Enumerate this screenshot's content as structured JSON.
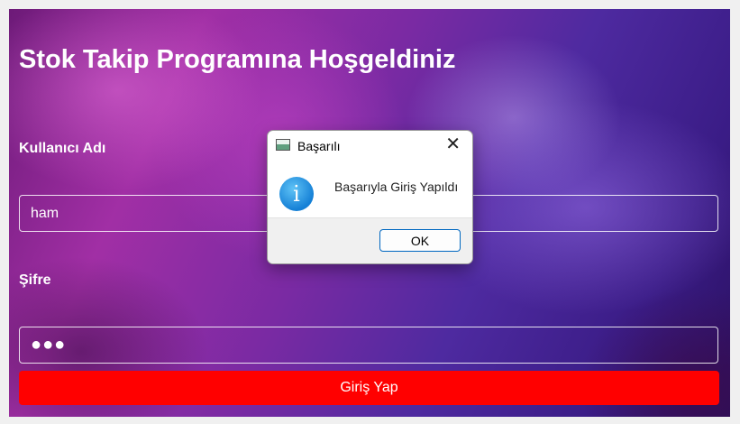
{
  "app": {
    "title": "Stok Takip Programına Hoşgeldiniz",
    "username_label": "Kullanıcı Adı",
    "username_value": "ham",
    "password_label": "Şifre",
    "password_masked": "●●●",
    "login_button": "Giriş Yap"
  },
  "dialog": {
    "title": "Başarılı",
    "message": "Başarıyla Giriş Yapıldı",
    "ok_button": "OK",
    "close_symbol": "✕",
    "info_symbol": "i"
  },
  "colors": {
    "login_button": "#ff0000",
    "info_icon": "#1580d6"
  }
}
